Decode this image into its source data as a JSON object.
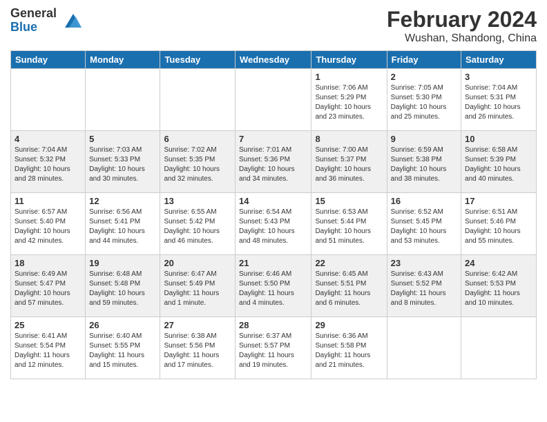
{
  "header": {
    "logo": {
      "general": "General",
      "blue": "Blue"
    },
    "title": "February 2024",
    "subtitle": "Wushan, Shandong, China"
  },
  "columns": [
    "Sunday",
    "Monday",
    "Tuesday",
    "Wednesday",
    "Thursday",
    "Friday",
    "Saturday"
  ],
  "weeks": [
    [
      {
        "day": "",
        "info": ""
      },
      {
        "day": "",
        "info": ""
      },
      {
        "day": "",
        "info": ""
      },
      {
        "day": "",
        "info": ""
      },
      {
        "day": "1",
        "info": "Sunrise: 7:06 AM\nSunset: 5:29 PM\nDaylight: 10 hours\nand 23 minutes."
      },
      {
        "day": "2",
        "info": "Sunrise: 7:05 AM\nSunset: 5:30 PM\nDaylight: 10 hours\nand 25 minutes."
      },
      {
        "day": "3",
        "info": "Sunrise: 7:04 AM\nSunset: 5:31 PM\nDaylight: 10 hours\nand 26 minutes."
      }
    ],
    [
      {
        "day": "4",
        "info": "Sunrise: 7:04 AM\nSunset: 5:32 PM\nDaylight: 10 hours\nand 28 minutes."
      },
      {
        "day": "5",
        "info": "Sunrise: 7:03 AM\nSunset: 5:33 PM\nDaylight: 10 hours\nand 30 minutes."
      },
      {
        "day": "6",
        "info": "Sunrise: 7:02 AM\nSunset: 5:35 PM\nDaylight: 10 hours\nand 32 minutes."
      },
      {
        "day": "7",
        "info": "Sunrise: 7:01 AM\nSunset: 5:36 PM\nDaylight: 10 hours\nand 34 minutes."
      },
      {
        "day": "8",
        "info": "Sunrise: 7:00 AM\nSunset: 5:37 PM\nDaylight: 10 hours\nand 36 minutes."
      },
      {
        "day": "9",
        "info": "Sunrise: 6:59 AM\nSunset: 5:38 PM\nDaylight: 10 hours\nand 38 minutes."
      },
      {
        "day": "10",
        "info": "Sunrise: 6:58 AM\nSunset: 5:39 PM\nDaylight: 10 hours\nand 40 minutes."
      }
    ],
    [
      {
        "day": "11",
        "info": "Sunrise: 6:57 AM\nSunset: 5:40 PM\nDaylight: 10 hours\nand 42 minutes."
      },
      {
        "day": "12",
        "info": "Sunrise: 6:56 AM\nSunset: 5:41 PM\nDaylight: 10 hours\nand 44 minutes."
      },
      {
        "day": "13",
        "info": "Sunrise: 6:55 AM\nSunset: 5:42 PM\nDaylight: 10 hours\nand 46 minutes."
      },
      {
        "day": "14",
        "info": "Sunrise: 6:54 AM\nSunset: 5:43 PM\nDaylight: 10 hours\nand 48 minutes."
      },
      {
        "day": "15",
        "info": "Sunrise: 6:53 AM\nSunset: 5:44 PM\nDaylight: 10 hours\nand 51 minutes."
      },
      {
        "day": "16",
        "info": "Sunrise: 6:52 AM\nSunset: 5:45 PM\nDaylight: 10 hours\nand 53 minutes."
      },
      {
        "day": "17",
        "info": "Sunrise: 6:51 AM\nSunset: 5:46 PM\nDaylight: 10 hours\nand 55 minutes."
      }
    ],
    [
      {
        "day": "18",
        "info": "Sunrise: 6:49 AM\nSunset: 5:47 PM\nDaylight: 10 hours\nand 57 minutes."
      },
      {
        "day": "19",
        "info": "Sunrise: 6:48 AM\nSunset: 5:48 PM\nDaylight: 10 hours\nand 59 minutes."
      },
      {
        "day": "20",
        "info": "Sunrise: 6:47 AM\nSunset: 5:49 PM\nDaylight: 11 hours\nand 1 minute."
      },
      {
        "day": "21",
        "info": "Sunrise: 6:46 AM\nSunset: 5:50 PM\nDaylight: 11 hours\nand 4 minutes."
      },
      {
        "day": "22",
        "info": "Sunrise: 6:45 AM\nSunset: 5:51 PM\nDaylight: 11 hours\nand 6 minutes."
      },
      {
        "day": "23",
        "info": "Sunrise: 6:43 AM\nSunset: 5:52 PM\nDaylight: 11 hours\nand 8 minutes."
      },
      {
        "day": "24",
        "info": "Sunrise: 6:42 AM\nSunset: 5:53 PM\nDaylight: 11 hours\nand 10 minutes."
      }
    ],
    [
      {
        "day": "25",
        "info": "Sunrise: 6:41 AM\nSunset: 5:54 PM\nDaylight: 11 hours\nand 12 minutes."
      },
      {
        "day": "26",
        "info": "Sunrise: 6:40 AM\nSunset: 5:55 PM\nDaylight: 11 hours\nand 15 minutes."
      },
      {
        "day": "27",
        "info": "Sunrise: 6:38 AM\nSunset: 5:56 PM\nDaylight: 11 hours\nand 17 minutes."
      },
      {
        "day": "28",
        "info": "Sunrise: 6:37 AM\nSunset: 5:57 PM\nDaylight: 11 hours\nand 19 minutes."
      },
      {
        "day": "29",
        "info": "Sunrise: 6:36 AM\nSunset: 5:58 PM\nDaylight: 11 hours\nand 21 minutes."
      },
      {
        "day": "",
        "info": ""
      },
      {
        "day": "",
        "info": ""
      }
    ]
  ]
}
